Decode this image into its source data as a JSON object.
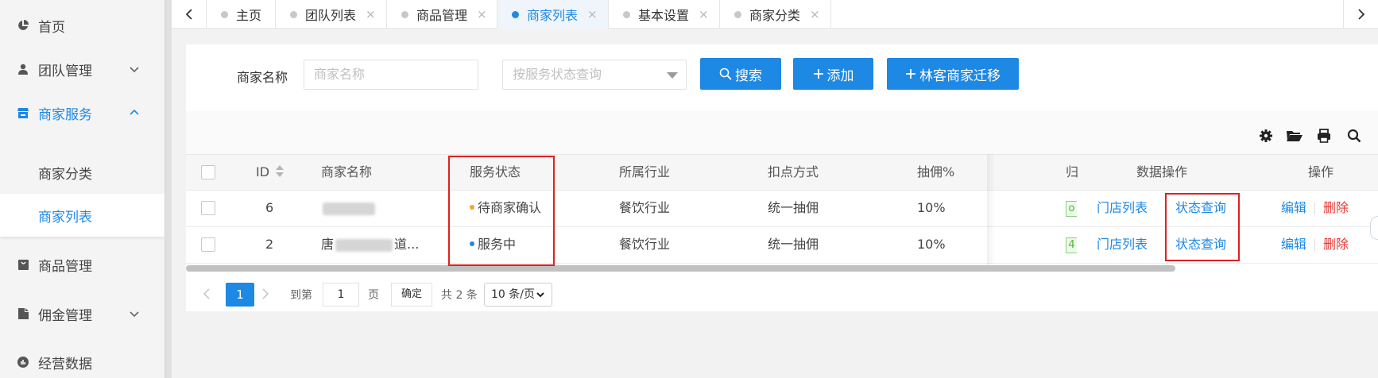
{
  "sidebar": {
    "items": [
      {
        "label": "首页"
      },
      {
        "label": "团队管理"
      },
      {
        "label": "商家服务"
      },
      {
        "label": "商家分类"
      },
      {
        "label": "商家列表"
      },
      {
        "label": "商品管理"
      },
      {
        "label": "佣金管理"
      },
      {
        "label": "经营数据"
      }
    ]
  },
  "tabs": [
    {
      "label": "主页",
      "closable": false
    },
    {
      "label": "团队列表",
      "closable": true
    },
    {
      "label": "商品管理",
      "closable": true
    },
    {
      "label": "商家列表",
      "closable": true,
      "active": true
    },
    {
      "label": "基本设置",
      "closable": true
    },
    {
      "label": "商家分类",
      "closable": true
    }
  ],
  "tab_close": "×",
  "search": {
    "label": "商家名称",
    "name_placeholder": "商家名称",
    "status_placeholder": "按服务状态查询",
    "search_button": "搜索",
    "add_button": "添加",
    "migrate_button": "林客商家迁移"
  },
  "table": {
    "headers": {
      "id": "ID",
      "name": "商家名称",
      "status": "服务状态",
      "industry": "所属行业",
      "deduct": "扣点方式",
      "commission": "抽佣%",
      "belong": "归",
      "data_ops": "数据操作",
      "ops": "操作"
    },
    "rows": [
      {
        "id": "6",
        "name": "",
        "status": "待商家确认",
        "status_color": "#f5a623",
        "industry": "餐饮行业",
        "deduct": "统一抽佣",
        "commission": "10%",
        "belong_badge": "o",
        "store_list": "门店列表",
        "status_query": "状态查询",
        "edit": "编辑",
        "delete": "删除"
      },
      {
        "id": "2",
        "name_prefix": "唐",
        "name_suffix": "道...",
        "status": "服务中",
        "status_color": "#1e88e5",
        "industry": "餐饮行业",
        "deduct": "统一抽佣",
        "commission": "10%",
        "belong_badge": "4",
        "store_list": "门店列表",
        "status_query": "状态查询",
        "edit": "编辑",
        "delete": "删除"
      }
    ]
  },
  "pagination": {
    "current": "1",
    "goto_label": "到第",
    "goto_value": "1",
    "page_label": "页",
    "confirm": "确定",
    "total": "共 2 条",
    "page_size": "10 条/页"
  },
  "colors": {
    "accent": "#1e88e5",
    "danger": "#e53935",
    "highlight_box": "#e02020"
  }
}
